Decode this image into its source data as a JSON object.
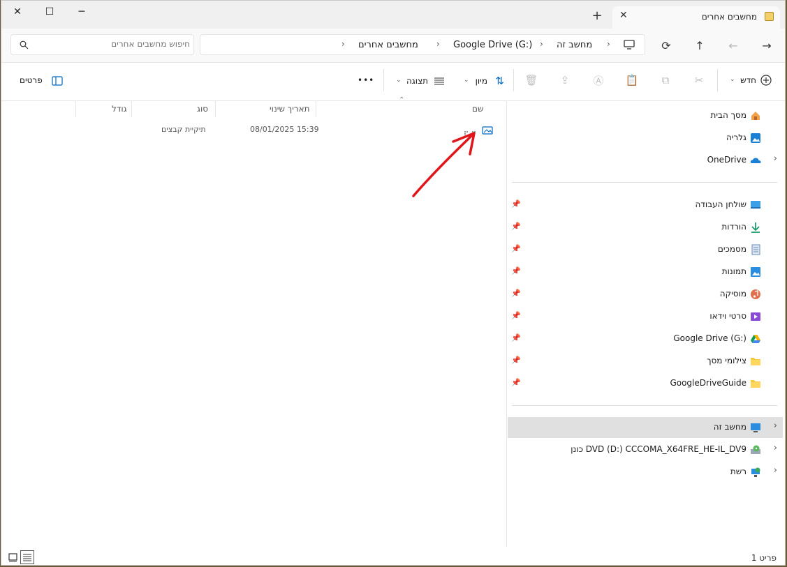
{
  "window": {
    "minimize_glyph": "─",
    "maximize_glyph": "☐",
    "close_glyph": "✕"
  },
  "tab": {
    "title": "מחשבים אחרים",
    "close_glyph": "✕",
    "new_tab_glyph": "+"
  },
  "nav": {
    "back_glyph": "←",
    "forward_glyph": "→",
    "up_glyph": "↑",
    "refresh_glyph": "⟳",
    "monitor_glyph": "🖵"
  },
  "breadcrumb": [
    "מחשב זה",
    "Google Drive (G:)",
    "מחשבים אחרים"
  ],
  "search": {
    "placeholder": "חיפוש מחשבים אחרים"
  },
  "commands": {
    "new": "חדש",
    "sort": "מיון",
    "view": "תצוגה",
    "more": "•••",
    "details": "פרטים"
  },
  "columns": {
    "name": "שם",
    "modified": "תאריך שינוי",
    "type": "סוג",
    "size": "גודל"
  },
  "rows": [
    {
      "name": "",
      "modified": "08/01/2025 15:39",
      "type": "תיקיית קבצים",
      "size": ""
    }
  ],
  "sidebar": {
    "top": [
      {
        "label": "מסך הבית",
        "icon": "home-icon"
      },
      {
        "label": "גלריה",
        "icon": "gallery-icon"
      },
      {
        "label": "OneDrive",
        "icon": "onedrive-icon"
      }
    ],
    "quick": [
      {
        "label": "שולחן העבודה",
        "icon": "desktop-icon"
      },
      {
        "label": "הורדות",
        "icon": "downloads-icon"
      },
      {
        "label": "מסמכים",
        "icon": "documents-icon"
      },
      {
        "label": "תמונות",
        "icon": "pictures-icon"
      },
      {
        "label": "מוסיקה",
        "icon": "music-icon"
      },
      {
        "label": "סרטי וידאו",
        "icon": "videos-icon"
      },
      {
        "label": "Google Drive (G:)",
        "icon": "google-drive-icon"
      },
      {
        "label": "צילומי מסך",
        "icon": "folder-icon"
      },
      {
        "label": "GoogleDriveGuide",
        "icon": "folder-icon"
      }
    ],
    "bottom": [
      {
        "label": "מחשב זה",
        "icon": "this-pc-icon"
      },
      {
        "label": "כונן DVD‏ (D:) CCCOMA_X64FRE_HE-IL_DV9",
        "icon": "dvd-drive-icon"
      },
      {
        "label": "רשת",
        "icon": "network-icon"
      }
    ]
  },
  "status": {
    "item_count": "פריט 1"
  },
  "colors": {
    "accent": "#0067c0",
    "selection": "#e0e0e0",
    "annotation": "#e0161b"
  }
}
